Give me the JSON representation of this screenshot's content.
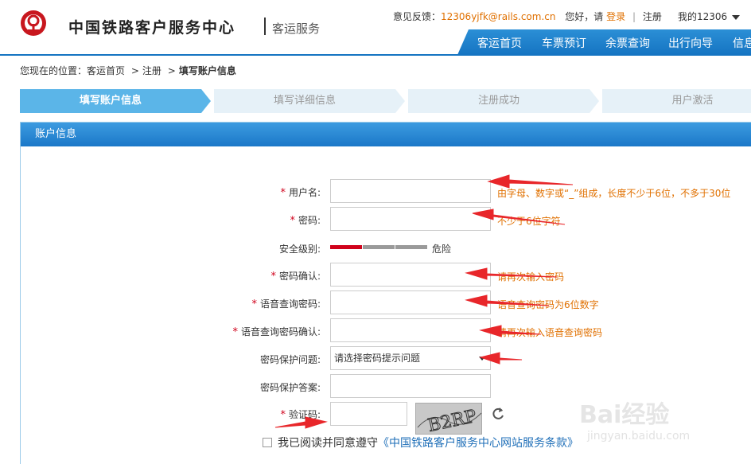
{
  "header": {
    "title": "中国铁路客户服务中心",
    "subtitle": "客运服务",
    "feedback_label": "意见反馈：",
    "feedback_email": "12306yjfk@rails.com.cn",
    "greeting": "您好，请",
    "login": "登录",
    "divider": "|",
    "register": "注册",
    "my12306": "我的12306",
    "nav": [
      "客运首页",
      "车票预订",
      "余票查询",
      "出行向导",
      "信息"
    ]
  },
  "breadcrumb": {
    "prefix": "您现在的位置：",
    "home": "客运首页",
    "sep1": ">",
    "register": "注册",
    "sep2": ">",
    "current": "填写账户信息"
  },
  "steps": [
    "填写账户信息",
    "填写详细信息",
    "注册成功",
    "用户激活"
  ],
  "panel": {
    "title": "账户信息"
  },
  "form": {
    "required_mark": "*",
    "username_label": "用户名:",
    "username_hint": "由字母、数字或“_”组成，长度不少于6位，不多于30位",
    "password_label": "密码:",
    "password_hint": "不少于6位字符",
    "security_label": "安全级别:",
    "security_text": "危险",
    "security_level": 1,
    "security_levels_total": 3,
    "confirm_label": "密码确认:",
    "confirm_hint": "请再次输入密码",
    "voice_label": "语音查询密码:",
    "voice_hint": "语音查询密码为6位数字",
    "voice_confirm_label": "语音查询密码确认:",
    "voice_confirm_hint": "请再次输入语音查询密码",
    "question_label": "密码保护问题:",
    "question_value": "请选择密码提示问题",
    "answer_label": "密码保护答案:",
    "captcha_label": "验证码:",
    "captcha_text": "B2RP",
    "agree_text": "我已阅读并同意遵守",
    "agree_link": "《中国铁路客户服务中心网站服务条款》"
  },
  "colors": {
    "brand_blue": "#1574c2",
    "active_step": "#5bb5e8",
    "hint_orange": "#e07000",
    "danger_red": "#d0021b",
    "annotation_arrow": "#e8262a"
  },
  "watermark": {
    "logo": "Bai经验",
    "url": "jingyan.baidu.com"
  }
}
